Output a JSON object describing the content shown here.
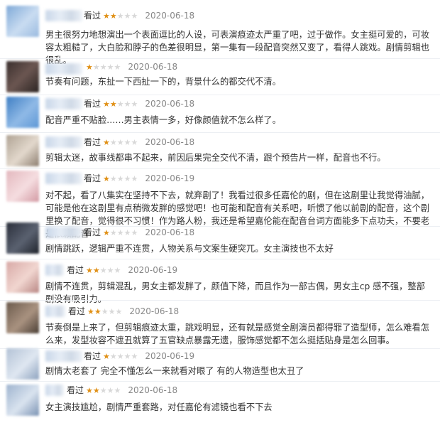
{
  "watched_label": "看过",
  "colors": {
    "star_on": "#e09015",
    "star_off": "#d8d8d8"
  },
  "comments": [
    {
      "rating": 2,
      "date": "2020-06-18",
      "text": "男主很努力地想演出一个表面逗比的人设，可表演痕迹太严重了吧，过于做作。女主挺可爱的，可妆容太粗糙了，大白脸和脖子的色差很明显，第一集有一段配音突然又变了，看得人跳戏。剧情剪辑也很乱。"
    },
    {
      "rating": 1,
      "date": "2020-06-18",
      "text": "节奏有问题，东扯一下西扯一下的，背景什么的都交代不清。"
    },
    {
      "rating": 2,
      "date": "2020-06-18",
      "text": "配音严重不贴脸……男主表情一多，好像颜值就不怎么样了。"
    },
    {
      "rating": 1,
      "date": "2020-06-18",
      "text": "剪辑太迷，故事线都串不起来，前因后果完全交代不清，跟个预告片一样，配音也不行。"
    },
    {
      "rating": 1,
      "date": "2020-06-19",
      "text": "对不起，看了八集实在坚持不下去，就弃剧了！我看过很多任嘉伦的剧，但在这剧里让我觉得油腻，可能是他在这剧里有点稍微发胖的感觉吧！也可能和配音有关系吧，听惯了他以前剧的配音，这个剧里换了配音，觉得很不习惯！作为路人粉，我还是希望嘉伦能在配音台词方面能多下点功夫，不要老是依赖配音"
    },
    {
      "rating": 1,
      "date": "2020-06-18",
      "text": "剧情跳跃，逻辑严重不连贯，人物关系与文案生硬突兀。女主演技也不太好"
    },
    {
      "rating": 2,
      "date": "2020-06-19",
      "text": "剧情不连贯，剪辑混乱，男女主都发胖了，颜值下降，而且作为一部古偶，男女主cp 感不强，整部剧没有吸引力。"
    },
    {
      "rating": 2,
      "date": "2020-06-18",
      "text": "节奏倒是上来了，但剪辑痕迹太重，跳戏明显，还有就是感觉全剧演员都得罪了造型师，怎么难看怎么来，发型妆容不遮丑就算了五官缺点暴露无遗，服饰感觉都不怎么挺括贴身是怎么回事。"
    },
    {
      "rating": 1,
      "date": "2020-06-19",
      "text": "剧情太老套了 完全不懂怎么一来就看对眼了 有的人物造型也太丑了"
    },
    {
      "rating": 2,
      "date": "2020-06-18",
      "text": "女主演技尴尬，剧情严重套路，对任嘉伦有滤镜也看不下去"
    }
  ]
}
